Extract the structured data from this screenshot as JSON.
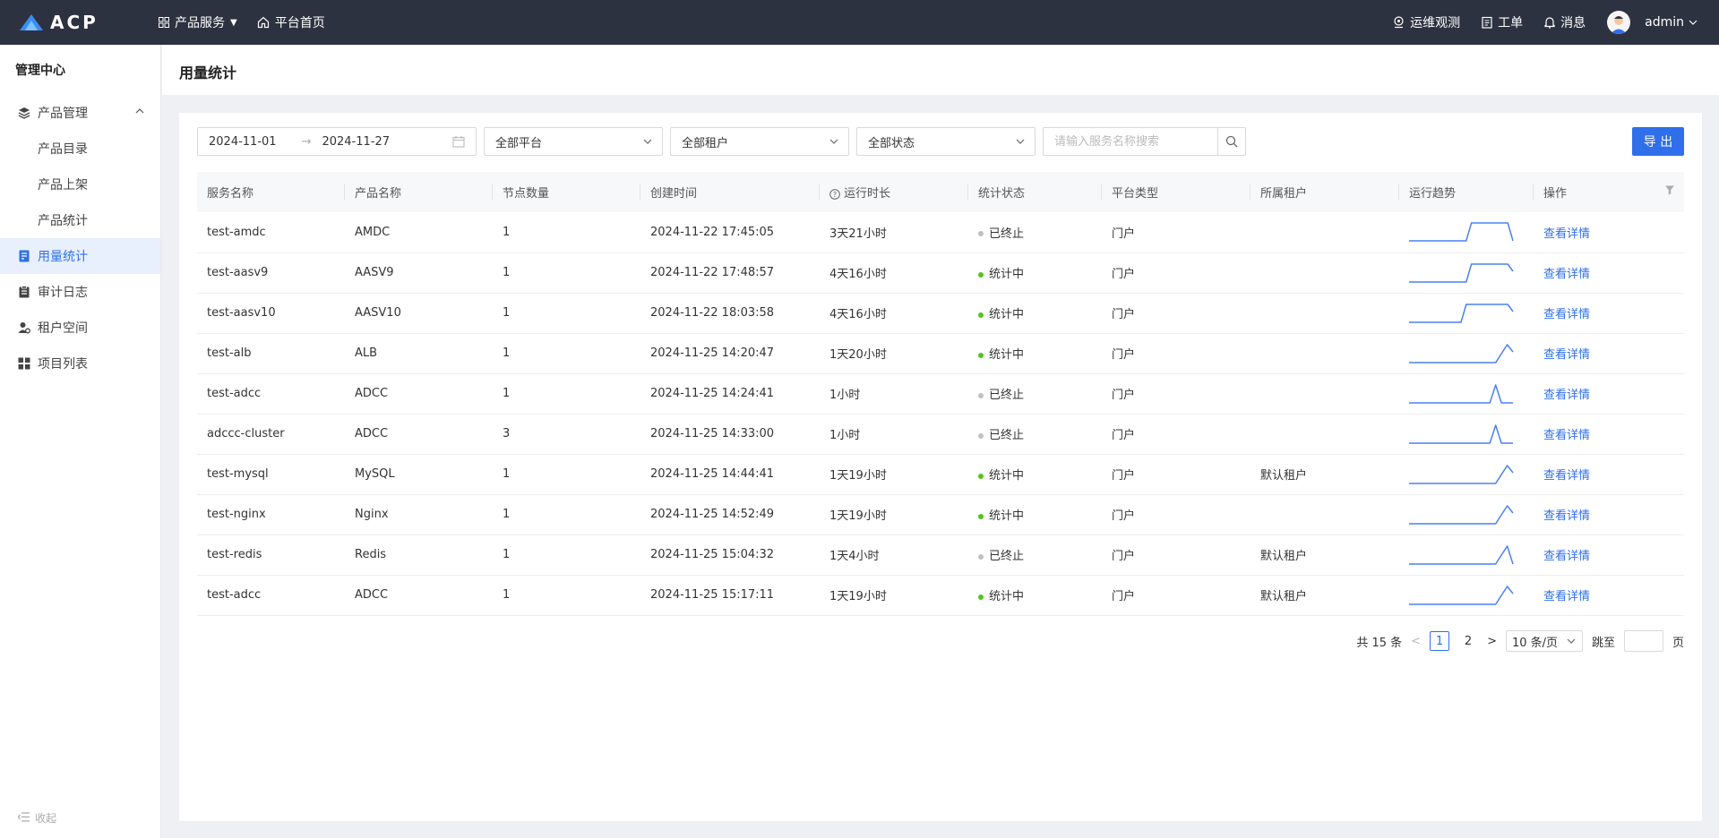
{
  "topbar": {
    "logo_text": "ACP",
    "nav": [
      {
        "label": "产品服务",
        "icon": "grid-icon",
        "has_caret": true
      },
      {
        "label": "平台首页",
        "icon": "home-icon"
      }
    ],
    "right": [
      {
        "label": "运维观测",
        "icon": "location-icon"
      },
      {
        "label": "工单",
        "icon": "clipboard-icon"
      },
      {
        "label": "消息",
        "icon": "bell-icon"
      }
    ],
    "user": "admin"
  },
  "sidebar": {
    "title": "管理中心",
    "group": {
      "label": "产品管理",
      "icon": "layers-icon",
      "expanded": true
    },
    "sub_items": [
      "产品目录",
      "产品上架",
      "产品统计"
    ],
    "items": [
      {
        "label": "用量统计",
        "icon": "chart-doc-icon",
        "active": true
      },
      {
        "label": "审计日志",
        "icon": "clipboard-icon"
      },
      {
        "label": "租户空间",
        "icon": "user-gear-icon"
      },
      {
        "label": "项目列表",
        "icon": "apps-icon"
      }
    ],
    "collapse_label": "收起"
  },
  "page": {
    "title": "用量统计"
  },
  "filters": {
    "date_start": "2024-11-01",
    "date_end": "2024-11-27",
    "date_sep": "→",
    "platform": "全部平台",
    "tenant": "全部租户",
    "status": "全部状态",
    "search_placeholder": "请输入服务名称搜索",
    "export_label": "导 出"
  },
  "table": {
    "columns": [
      "服务名称",
      "产品名称",
      "节点数量",
      "创建时间",
      "运行时长",
      "统计状态",
      "平台类型",
      "所属租户",
      "运行趋势",
      "操作"
    ],
    "action_label": "查看详情",
    "status_colors": {
      "已终止": "#c0c0c0",
      "统计中": "#52c41a"
    },
    "rows": [
      {
        "name": "test-amdc",
        "product": "AMDC",
        "nodes": "1",
        "created": "2024-11-22 17:45:05",
        "duration": "3天21小时",
        "status": "已终止",
        "platform": "门户",
        "tenant": "",
        "trend": [
          0,
          0,
          0,
          0,
          0,
          0,
          0,
          0,
          0,
          0,
          0,
          0,
          1,
          1,
          1,
          1,
          1,
          1,
          1,
          1,
          0
        ]
      },
      {
        "name": "test-aasv9",
        "product": "AASV9",
        "nodes": "1",
        "created": "2024-11-22 17:48:57",
        "duration": "4天16小时",
        "status": "统计中",
        "platform": "门户",
        "tenant": "",
        "trend": [
          0,
          0,
          0,
          0,
          0,
          0,
          0,
          0,
          0,
          0,
          0,
          0,
          1,
          1,
          1,
          1,
          1,
          1,
          1,
          1,
          0.6
        ]
      },
      {
        "name": "test-aasv10",
        "product": "AASV10",
        "nodes": "1",
        "created": "2024-11-22 18:03:58",
        "duration": "4天16小时",
        "status": "统计中",
        "platform": "门户",
        "tenant": "",
        "trend": [
          0,
          0,
          0,
          0,
          0,
          0,
          0,
          0,
          0,
          0,
          0,
          1,
          1,
          1,
          1,
          1,
          1,
          1,
          1,
          1,
          0.6
        ]
      },
      {
        "name": "test-alb",
        "product": "ALB",
        "nodes": "1",
        "created": "2024-11-25 14:20:47",
        "duration": "1天20小时",
        "status": "统计中",
        "platform": "门户",
        "tenant": "",
        "trend": [
          0,
          0,
          0,
          0,
          0,
          0,
          0,
          0,
          0,
          0,
          0,
          0,
          0,
          0,
          0,
          0,
          0.5,
          1,
          0.6
        ]
      },
      {
        "name": "test-adcc",
        "product": "ADCC",
        "nodes": "1",
        "created": "2024-11-25 14:24:41",
        "duration": "1小时",
        "status": "已终止",
        "platform": "门户",
        "tenant": "",
        "trend": [
          0,
          0,
          0,
          0,
          0,
          0,
          0,
          0,
          0,
          0,
          0,
          0,
          0,
          0,
          0,
          1,
          0,
          0,
          0
        ]
      },
      {
        "name": "adccc-cluster",
        "product": "ADCC",
        "nodes": "3",
        "created": "2024-11-25 14:33:00",
        "duration": "1小时",
        "status": "已终止",
        "platform": "门户",
        "tenant": "",
        "trend": [
          0,
          0,
          0,
          0,
          0,
          0,
          0,
          0,
          0,
          0,
          0,
          0,
          0,
          0,
          0,
          1,
          0,
          0,
          0
        ]
      },
      {
        "name": "test-mysql",
        "product": "MySQL",
        "nodes": "1",
        "created": "2024-11-25 14:44:41",
        "duration": "1天19小时",
        "status": "统计中",
        "platform": "门户",
        "tenant": "默认租户",
        "trend": [
          0,
          0,
          0,
          0,
          0,
          0,
          0,
          0,
          0,
          0,
          0,
          0,
          0,
          0,
          0,
          0,
          0.5,
          1,
          0.6
        ]
      },
      {
        "name": "test-nginx",
        "product": "Nginx",
        "nodes": "1",
        "created": "2024-11-25 14:52:49",
        "duration": "1天19小时",
        "status": "统计中",
        "platform": "门户",
        "tenant": "",
        "trend": [
          0,
          0,
          0,
          0,
          0,
          0,
          0,
          0,
          0,
          0,
          0,
          0,
          0,
          0,
          0,
          0,
          0.5,
          1,
          0.6
        ]
      },
      {
        "name": "test-redis",
        "product": "Redis",
        "nodes": "1",
        "created": "2024-11-25 15:04:32",
        "duration": "1天4小时",
        "status": "已终止",
        "platform": "门户",
        "tenant": "默认租户",
        "trend": [
          0,
          0,
          0,
          0,
          0,
          0,
          0,
          0,
          0,
          0,
          0,
          0,
          0,
          0,
          0,
          0,
          0.5,
          1,
          0
        ]
      },
      {
        "name": "test-adcc",
        "product": "ADCC",
        "nodes": "1",
        "created": "2024-11-25 15:17:11",
        "duration": "1天19小时",
        "status": "统计中",
        "platform": "门户",
        "tenant": "默认租户",
        "trend": [
          0,
          0,
          0,
          0,
          0,
          0,
          0,
          0,
          0,
          0,
          0,
          0,
          0,
          0,
          0,
          0,
          0.5,
          1,
          0.6
        ]
      }
    ]
  },
  "pager": {
    "total_label": "共 15 条",
    "pages": [
      "1",
      "2"
    ],
    "current": "1",
    "size_label": "10 条/页",
    "jump_label": "跳至",
    "page_suffix": "页"
  },
  "colors": {
    "accent": "#2f6fea",
    "topbar": "#2d3240",
    "trend_line": "#4a80f0"
  }
}
